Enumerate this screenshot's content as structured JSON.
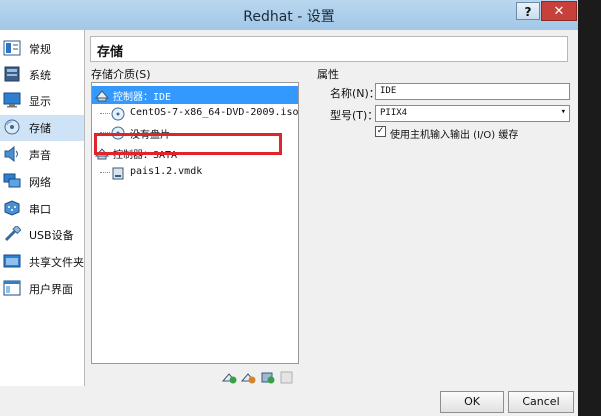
{
  "window": {
    "title": "Redhat - 设置",
    "help_label": "?",
    "close_label": "✕"
  },
  "sidebar": {
    "items": [
      {
        "label": "常规",
        "icon": "general-icon"
      },
      {
        "label": "系统",
        "icon": "system-icon"
      },
      {
        "label": "显示",
        "icon": "display-icon"
      },
      {
        "label": "存储",
        "icon": "storage-icon",
        "active": true
      },
      {
        "label": "声音",
        "icon": "audio-icon"
      },
      {
        "label": "网络",
        "icon": "network-icon"
      },
      {
        "label": "串口",
        "icon": "serial-port-icon"
      },
      {
        "label": "USB设备",
        "icon": "usb-icon"
      },
      {
        "label": "共享文件夹",
        "icon": "shared-folder-icon"
      },
      {
        "label": "用户界面",
        "icon": "user-interface-icon"
      }
    ]
  },
  "page": {
    "heading": "存储"
  },
  "storage": {
    "tree_label": "存储介质(S)",
    "tree": [
      {
        "label": "控制器：IDE",
        "icon": "controller-icon",
        "selected": true
      },
      {
        "label": "CentOS-7-x86_64-DVD-2009.iso",
        "icon": "optical-disc-icon"
      },
      {
        "label": "没有盘片",
        "icon": "optical-disc-icon"
      },
      {
        "label": "控制器：SATA",
        "icon": "controller-icon"
      },
      {
        "label": "pais1.2.vmdk",
        "icon": "hard-disk-icon"
      }
    ]
  },
  "properties": {
    "section_label": "属性",
    "name_label": "名称(N)：",
    "name_value": "IDE",
    "type_label": "型号(T)：",
    "type_value": "PIIX4",
    "host_io_label": "使用主机输入输出 (I/O) 缓存",
    "host_io_checked": true
  },
  "footer": {
    "ok_label": "OK",
    "cancel_label": "Cancel"
  },
  "colors": {
    "highlight": "#3399ff",
    "annotation_red": "#e0242a",
    "title_blue": "#a2c7e7"
  }
}
